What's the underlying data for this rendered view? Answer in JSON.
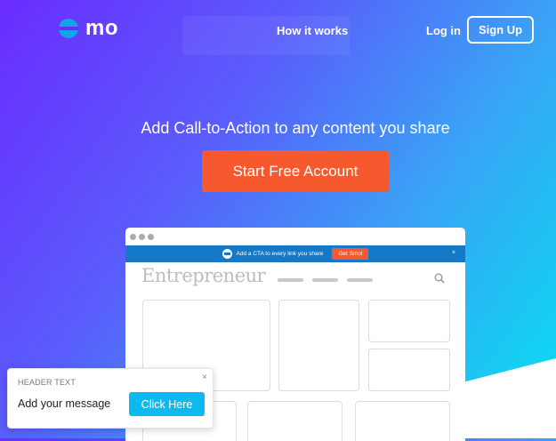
{
  "brand": {
    "name": "mo"
  },
  "nav": {
    "how_it_works": "How it works",
    "login": "Log in",
    "signup": "Sign Up"
  },
  "hero": {
    "headline": "Add Call-to-Action to any content you share",
    "cta": "Start Free Account"
  },
  "mockup": {
    "smol_bar_text": "Add a CTA to every link you share",
    "smol_button": "Get Smol",
    "smol_close": "×",
    "site_name": "Entrepreneur"
  },
  "popup": {
    "header": "HEADER TEXT",
    "message": "Add your message",
    "button": "Click Here",
    "close": "×"
  },
  "colors": {
    "gradient_start": "#6a2cff",
    "gradient_end": "#06e0f0",
    "cta": "#f5592d",
    "bar_blue": "#1479c9",
    "popup_button": "#0cbaf0"
  }
}
